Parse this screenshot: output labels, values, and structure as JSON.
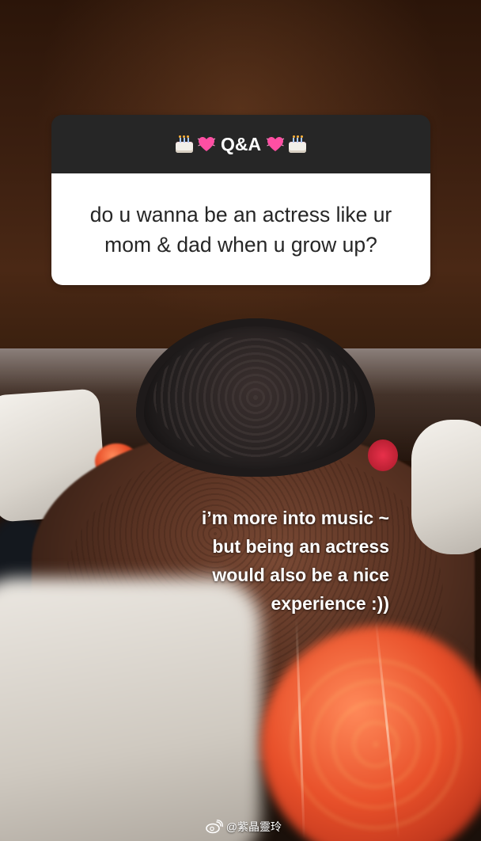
{
  "qa_sticker": {
    "title": "Q&A",
    "title_left_icons": [
      "birthday-cake-icon",
      "heart-icon"
    ],
    "title_right_icons": [
      "heart-icon",
      "birthday-cake-icon"
    ],
    "question": "do u wanna be an actress like ur mom & dad when u grow up?"
  },
  "answer": {
    "lines": [
      "i’m more into music ~",
      "but being an actress",
      "would also be a nice",
      "experience :))"
    ]
  },
  "watermark": {
    "logo": "weibo-logo",
    "text": "@紫晶靈玲"
  },
  "colors": {
    "sticker_header": "#262626",
    "sticker_body": "#ffffff",
    "question_text": "#262626",
    "answer_text": "#ffffff",
    "heart": "#ff4fa3"
  }
}
